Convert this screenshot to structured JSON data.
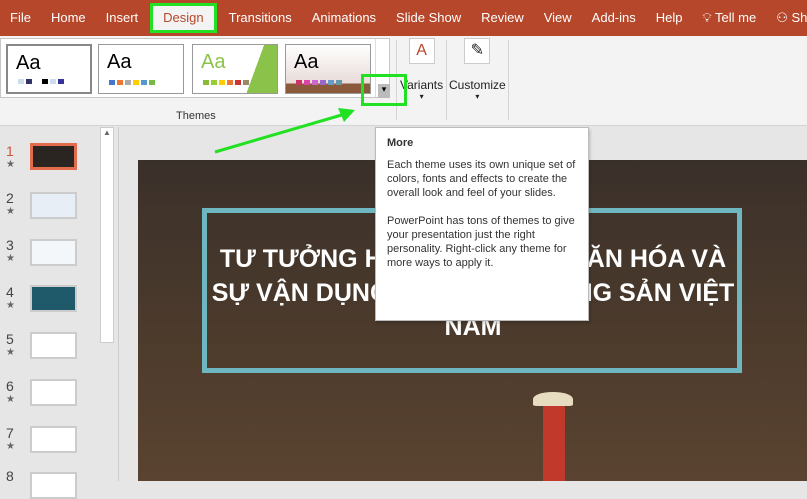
{
  "tabs": [
    "File",
    "Home",
    "Insert",
    "Design",
    "Transitions",
    "Animations",
    "Slide Show",
    "Review",
    "View",
    "Add-ins",
    "Help",
    "Tell me",
    "Share"
  ],
  "ribbon": {
    "theme_sample": "Aa",
    "themes_label": "Themes",
    "variants_label": "Variants",
    "customize_label": "Customize"
  },
  "slides": [
    "1",
    "2",
    "3",
    "4",
    "5",
    "6",
    "7",
    "8"
  ],
  "slide": {
    "title": "TƯ TƯỞNG HỒ CHÍ MINH VỀ VĂN HÓA VÀ SỰ VẬN DỤNG CỦA ĐẢNG CỘNG SẢN VIỆT NAM"
  },
  "tooltip": {
    "title": "More",
    "p1": "Each theme uses its own unique set of colors, fonts and effects to create the overall look and feel of your slides.",
    "p2": "PowerPoint has tons of themes to give your presentation just the right personality. Right-click any theme for more ways to apply it."
  },
  "colors": {
    "accent": "#b7472a",
    "highlight": "#22e022"
  }
}
